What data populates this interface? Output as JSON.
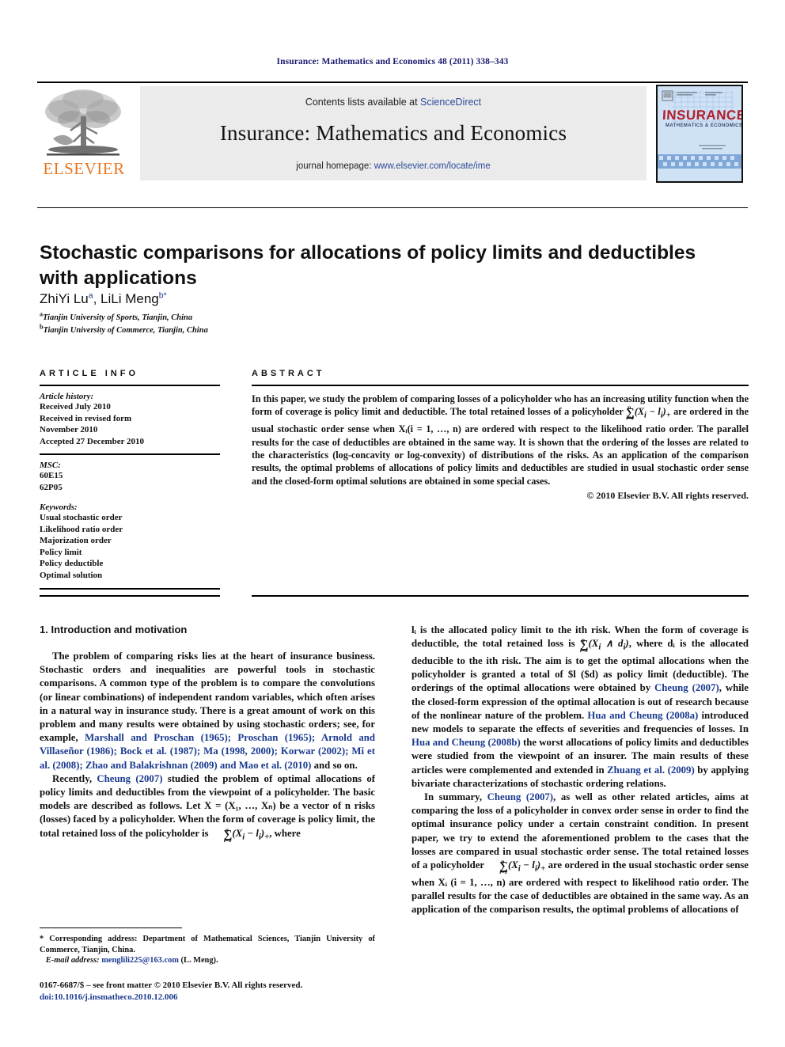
{
  "running_head": "Insurance: Mathematics and Economics 48 (2011) 338–343",
  "masthead": {
    "publisher_name": "ELSEVIER",
    "contents_prefix": "Contents lists available at ",
    "contents_link": "ScienceDirect",
    "journal_title": "Insurance: Mathematics and Economics",
    "homepage_prefix": "journal homepage: ",
    "homepage_link": "www.elsevier.com/locate/ime",
    "cover_title": "INSURANCE",
    "cover_subtitle": "MATHEMATICS & ECONOMICS"
  },
  "article": {
    "title": "Stochastic comparisons for allocations of policy limits and deductibles with applications",
    "author_1": "ZhiYi Lu",
    "author_1_sup": "a",
    "author_2": "LiLi Meng",
    "author_2_sup": "b",
    "author_2_star": "*",
    "affiliation_a_sup": "a",
    "affiliation_a": "Tianjin University of Sports, Tianjin, China",
    "affiliation_b_sup": "b",
    "affiliation_b": "Tianjin University of Commerce, Tianjin, China"
  },
  "article_info": {
    "heading": "ARTICLE INFO",
    "history_label": "Article history:",
    "history_lines": [
      "Received July 2010",
      "Received in revised form",
      "November 2010",
      "Accepted 27 December 2010"
    ],
    "msc_label": "MSC:",
    "msc_codes": [
      "60E15",
      "62P05"
    ],
    "keywords_label": "Keywords:",
    "keywords": [
      "Usual stochastic order",
      "Likelihood ratio order",
      "Majorization order",
      "Policy limit",
      "Policy deductible",
      "Optimal solution"
    ]
  },
  "abstract": {
    "heading": "ABSTRACT",
    "part_1": "In this paper, we study the problem of comparing losses of a policyholder who has an increasing utility function when the form of coverage is policy limit and deductible. The total retained losses of a policyholder ",
    "formula": "∑ (Xᵢ − lᵢ)₊",
    "part_2": " are ordered in the usual stochastic order sense when Xᵢ(i = 1, …, n) are ordered with respect to the likelihood ratio order. The parallel results for the case of deductibles are obtained in the same way. It is shown that the ordering of the losses are related to the characteristics (log-concavity or log-convexity) of distributions of the risks. As an application of the comparison results, the optimal problems of allocations of policy limits and deductibles are studied in usual stochastic order sense and the closed-form optimal solutions are obtained in some special cases.",
    "copyright": "© 2010 Elsevier B.V. All rights reserved."
  },
  "body": {
    "section_heading": "1. Introduction and motivation",
    "left_para_1_a": "The problem of comparing risks lies at the heart of insurance business. Stochastic orders and inequalities are powerful tools in stochastic comparisons. A common type of the problem is to compare the convolutions (or linear combinations) of independent random variables, which often arises in a natural way in insurance study. There is a great amount of work on this problem and many results were obtained by using stochastic orders; see, for example, ",
    "left_cites_1": "Marshall and Proschan (1965); Proschan (1965); Arnold and Villaseñor (1986); Bock et al. (1987); Ma (1998, 2000); Korwar (2002); Mi et al. (2008); Zhao and Balakrishnan (2009) and Mao et al. (2010)",
    "left_para_1_b": " and so on.",
    "left_para_2_a": "Recently, ",
    "left_cite_2": "Cheung (2007)",
    "left_para_2_b": " studied the problem of optimal allocations of policy limits and deductibles from the viewpoint of a policyholder. The basic models are described as follows. Let X = (X₁, …, Xₙ) be a vector of n risks (losses) faced by a policyholder. When the form of coverage is policy limit, the total retained loss of the policyholder is ",
    "left_para_2_c": ", where",
    "right_para_1_a": "lᵢ is the allocated policy limit to the ith risk. When the form of coverage is deductible, the total retained loss is ",
    "right_para_1_b": ", where dᵢ is the allocated deducible to the ith risk. The aim is to get the optimal allocations when the policyholder is granted a total of $l ($d) as policy limit (deductible). The orderings of the optimal allocations were obtained by ",
    "right_cite_1": "Cheung (2007)",
    "right_para_1_c": ", while the closed-form expression of the optimal allocation is out of research because of the nonlinear nature of the problem. ",
    "right_cite_2": "Hua and Cheung (2008a)",
    "right_para_1_d": " introduced new models to separate the effects of severities and frequencies of losses. In ",
    "right_cite_3": "Hua and Cheung (2008b)",
    "right_para_1_e": " the worst allocations of policy limits and deductibles were studied from the viewpoint of an insurer. The main results of these articles were complemented and extended in ",
    "right_cite_4": "Zhuang et al. (2009)",
    "right_para_1_f": " by applying bivariate characterizations of stochastic ordering relations.",
    "right_para_2_a": "In summary, ",
    "right_cite_5": "Cheung (2007)",
    "right_para_2_b": ", as well as other related articles, aims at comparing the loss of a policyholder in convex order sense in order to find the optimal insurance policy under a certain constraint condition. In present paper, we try to extend the aforementioned problem to the cases that the losses are compared in usual stochastic order sense. The total retained losses of a policyholder ",
    "right_para_2_c": " are ordered in the usual stochastic order sense when Xᵢ (i = 1, …, n) are ordered with respect to likelihood ratio order. The parallel results for the case of deductibles are obtained in the same way. As an application of the comparison results, the optimal problems of allocations of"
  },
  "footnotes": {
    "corresponding_star": "*",
    "corresponding_text": "Corresponding address: Department of Mathematical Sciences, Tianjin University of Commerce, Tianjin, China.",
    "email_label": "E-mail address:",
    "email": "menglili225@163.com",
    "email_suffix": "(L. Meng).",
    "issn_line": "0167-6687/$ – see front matter © 2010 Elsevier B.V. All rights reserved.",
    "doi_line": "doi:10.1016/j.insmatheco.2010.12.006"
  },
  "colors": {
    "link_blue": "#2b4b9b",
    "cite_blue": "#1a3a8f",
    "elsevier_orange": "#e87722",
    "running_head": "#1a1a6e",
    "banner_gray": "#ebebeb",
    "cover_blue": "#cfe1f5"
  }
}
